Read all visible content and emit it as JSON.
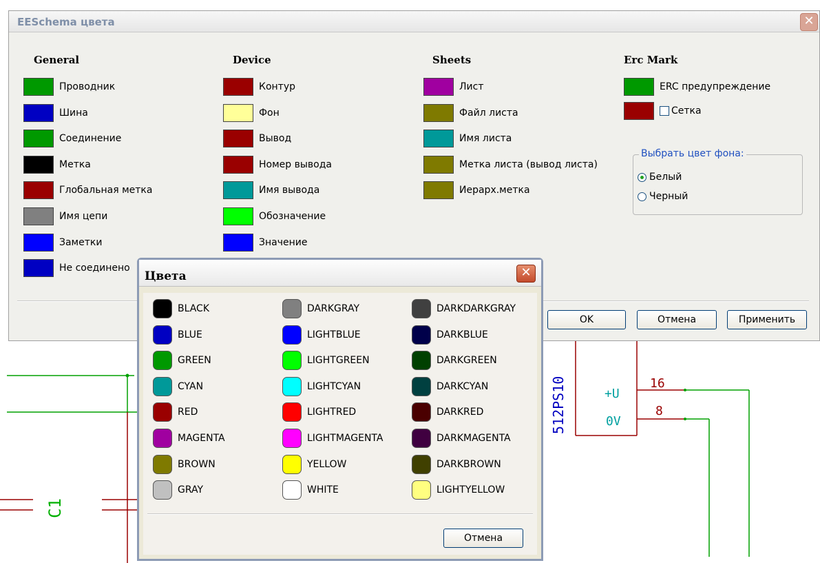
{
  "main_dialog": {
    "title": "EESchema цвета",
    "close_glyph": "✕",
    "columns": {
      "general": {
        "heading": "General",
        "items": [
          {
            "label": "Проводник",
            "color": "#009900"
          },
          {
            "label": "Шина",
            "color": "#0000c2"
          },
          {
            "label": "Соединение",
            "color": "#009900"
          },
          {
            "label": "Метка",
            "color": "#000000"
          },
          {
            "label": "Глобальная метка",
            "color": "#9a0000"
          },
          {
            "label": "Имя цепи",
            "color": "#808080"
          },
          {
            "label": "Заметки",
            "color": "#0000ff"
          },
          {
            "label": "Не соединено",
            "color": "#0000c2"
          }
        ]
      },
      "device": {
        "heading": "Device",
        "items": [
          {
            "label": "Контур",
            "color": "#9a0000"
          },
          {
            "label": "Фон",
            "color": "#ffff99"
          },
          {
            "label": "Вывод",
            "color": "#9a0000"
          },
          {
            "label": "Номер вывода",
            "color": "#9a0000"
          },
          {
            "label": "Имя вывода",
            "color": "#009999"
          },
          {
            "label": "Обозначение",
            "color": "#00ff00"
          },
          {
            "label": "Значение",
            "color": "#0000ff"
          }
        ]
      },
      "sheets": {
        "heading": "Sheets",
        "items": [
          {
            "label": "Лист",
            "color": "#a000a0"
          },
          {
            "label": "Файл листа",
            "color": "#7f7a00"
          },
          {
            "label": "Имя листа",
            "color": "#009999"
          },
          {
            "label": "Метка листа (вывод листа)",
            "color": "#7f7a00"
          },
          {
            "label": "Иерарх.метка",
            "color": "#7f7a00"
          }
        ]
      },
      "erc": {
        "heading": "Erc Mark",
        "items": [
          {
            "label": "ERC предупреждение",
            "color": "#009900"
          },
          {
            "label": "Сетка",
            "color": "#9a0000"
          }
        ]
      }
    },
    "background_group": {
      "title": "Выбрать цвет фона:",
      "options": [
        "Белый",
        "Черный"
      ],
      "selected": "Белый"
    },
    "buttons": {
      "ok": "OK",
      "cancel": "Отмена",
      "apply": "Применить"
    }
  },
  "colors_dialog": {
    "title": "Цвета",
    "close_glyph": "✕",
    "colors": [
      [
        {
          "name": "BLACK",
          "hex": "#000000"
        },
        {
          "name": "BLUE",
          "hex": "#0000c2"
        },
        {
          "name": "GREEN",
          "hex": "#009900"
        },
        {
          "name": "CYAN",
          "hex": "#009999"
        },
        {
          "name": "RED",
          "hex": "#9a0000"
        },
        {
          "name": "MAGENTA",
          "hex": "#a000a0"
        },
        {
          "name": "BROWN",
          "hex": "#7f7a00"
        },
        {
          "name": "GRAY",
          "hex": "#c0c0c0"
        }
      ],
      [
        {
          "name": "DARKGRAY",
          "hex": "#808080"
        },
        {
          "name": "LIGHTBLUE",
          "hex": "#0000ff"
        },
        {
          "name": "LIGHTGREEN",
          "hex": "#00ff00"
        },
        {
          "name": "LIGHTCYAN",
          "hex": "#00ffff"
        },
        {
          "name": "LIGHTRED",
          "hex": "#ff0000"
        },
        {
          "name": "LIGHTMAGENTA",
          "hex": "#ff00ff"
        },
        {
          "name": "YELLOW",
          "hex": "#ffff00"
        },
        {
          "name": "WHITE",
          "hex": "#ffffff"
        }
      ],
      [
        {
          "name": "DARKDARKGRAY",
          "hex": "#404040"
        },
        {
          "name": "DARKBLUE",
          "hex": "#00004a"
        },
        {
          "name": "DARKGREEN",
          "hex": "#004000"
        },
        {
          "name": "DARKCYAN",
          "hex": "#004040"
        },
        {
          "name": "DARKRED",
          "hex": "#4a0000"
        },
        {
          "name": "DARKMAGENTA",
          "hex": "#400040"
        },
        {
          "name": "DARKBROWN",
          "hex": "#404000"
        },
        {
          "name": "LIGHTYELLOW",
          "hex": "#ffff80"
        }
      ]
    ],
    "cancel_label": "Отмена"
  },
  "schematic": {
    "component_ref": "C1",
    "chip_name": "512PS10",
    "pin_plus_label": "+U",
    "pin_zero_label": "0V",
    "pin_number_16": "16",
    "pin_number_8": "8",
    "wire_color": "#00a000",
    "component_color": "#9a0000",
    "label_color": "#0000c0"
  }
}
